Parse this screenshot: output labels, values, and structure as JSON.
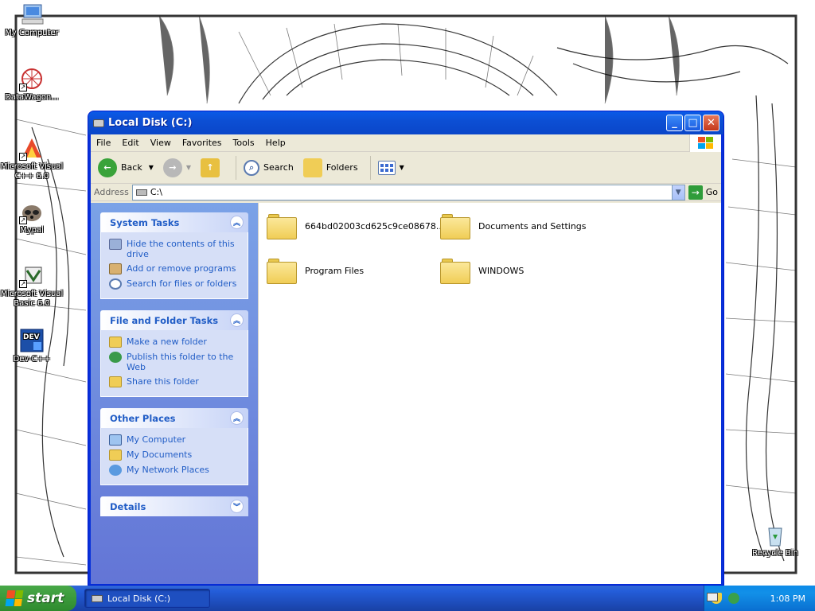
{
  "desktop": {
    "icons": [
      {
        "label": "My Computer"
      },
      {
        "label": "DataWagon..."
      },
      {
        "label": "Microsoft Visual C++ 6.0"
      },
      {
        "label": "Mypal"
      },
      {
        "label": "Microsoft Visual Basic 6.0"
      },
      {
        "label": "Dev-C++"
      }
    ],
    "recycle_bin": "Recycle Bin"
  },
  "window": {
    "title": "Local Disk (C:)",
    "menu": [
      "File",
      "Edit",
      "View",
      "Favorites",
      "Tools",
      "Help"
    ],
    "toolbar": {
      "back": "Back",
      "search": "Search",
      "folders": "Folders"
    },
    "address": {
      "label": "Address",
      "value": "C:\\",
      "go": "Go"
    },
    "panels": [
      {
        "title": "System Tasks",
        "links": [
          "Hide the contents of this drive",
          "Add or remove programs",
          "Search for files or folders"
        ]
      },
      {
        "title": "File and Folder Tasks",
        "links": [
          "Make a new folder",
          "Publish this folder to the Web",
          "Share this folder"
        ]
      },
      {
        "title": "Other Places",
        "links": [
          "My Computer",
          "My Documents",
          "My Network Places"
        ]
      },
      {
        "title": "Details",
        "links": []
      }
    ],
    "folders": [
      {
        "name": "664bd02003cd625c9ce08678..."
      },
      {
        "name": "Documents and Settings"
      },
      {
        "name": "Program Files"
      },
      {
        "name": "WINDOWS"
      }
    ]
  },
  "taskbar": {
    "start": "start",
    "active_task": "Local Disk (C:)",
    "clock": "1:08 PM"
  },
  "colors": {
    "titlebar": "#0a5ae8",
    "taskpane": "#7ba2e7",
    "start": "#3c9e3c"
  }
}
